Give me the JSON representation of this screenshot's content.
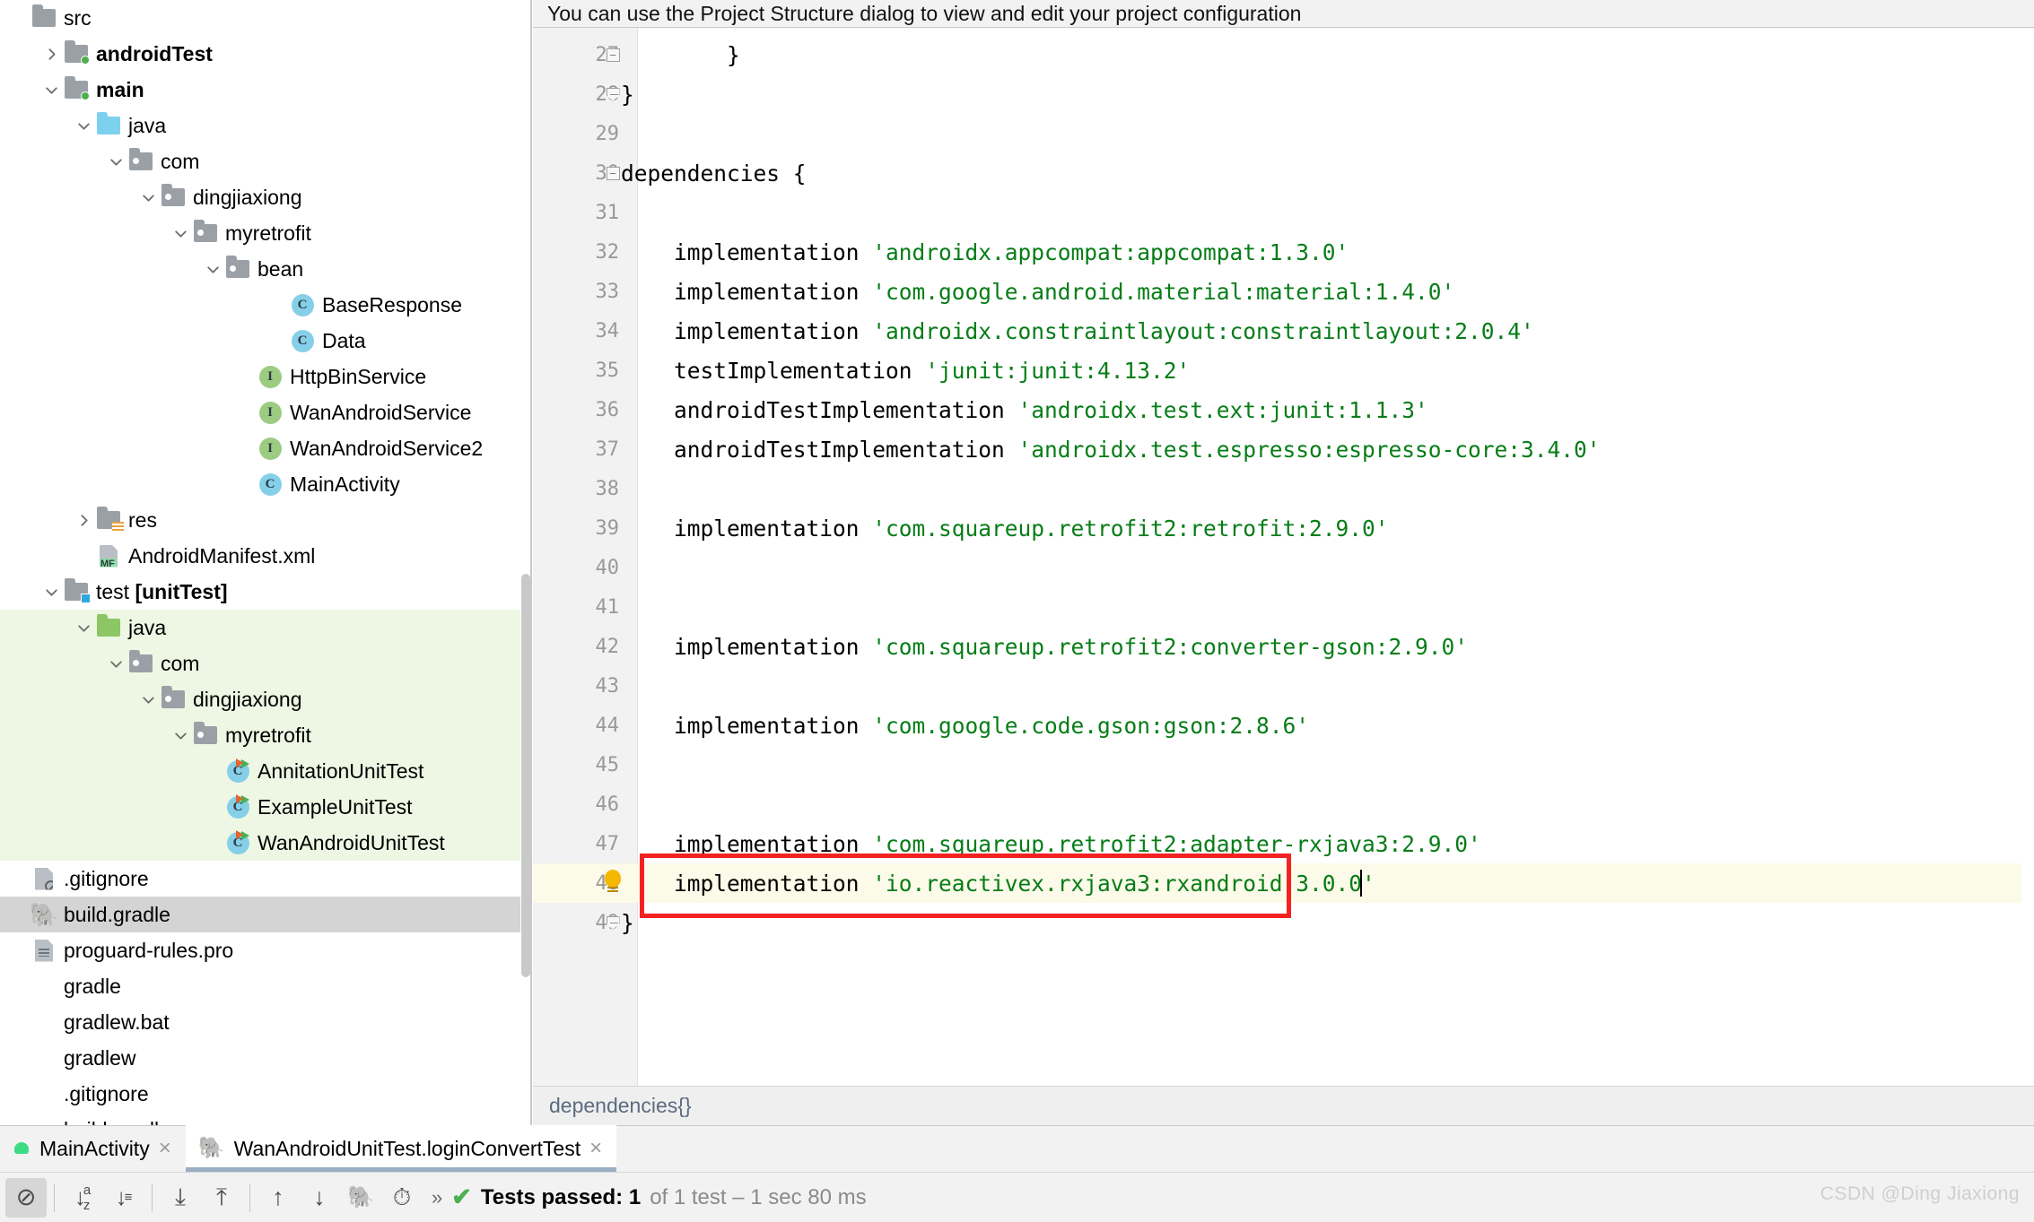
{
  "notification": {
    "text": "You can use the Project Structure dialog to view and edit your project configuration"
  },
  "project_tree": {
    "rows": [
      {
        "label": "src",
        "indent": 0,
        "icon": "folder-gray",
        "arrow": "none",
        "bold": false,
        "highlight": "none"
      },
      {
        "label": "androidTest",
        "indent": 1,
        "icon": "folder-source-green",
        "arrow": "collapsed",
        "bold": true,
        "highlight": "none"
      },
      {
        "label": "main",
        "indent": 1,
        "icon": "folder-source-green",
        "arrow": "expanded",
        "bold": true,
        "highlight": "none"
      },
      {
        "label": "java",
        "indent": 2,
        "icon": "folder-blue",
        "arrow": "expanded",
        "bold": false,
        "highlight": "none"
      },
      {
        "label": "com",
        "indent": 3,
        "icon": "folder-package",
        "arrow": "expanded",
        "bold": false,
        "highlight": "none"
      },
      {
        "label": "dingjiaxiong",
        "indent": 4,
        "icon": "folder-package",
        "arrow": "expanded",
        "bold": false,
        "highlight": "none"
      },
      {
        "label": "myretrofit",
        "indent": 5,
        "icon": "folder-package",
        "arrow": "expanded",
        "bold": false,
        "highlight": "none"
      },
      {
        "label": "bean",
        "indent": 6,
        "icon": "folder-package",
        "arrow": "expanded",
        "bold": false,
        "highlight": "none"
      },
      {
        "label": "BaseResponse",
        "indent": 8,
        "icon": "class-icon",
        "arrow": "none",
        "bold": false,
        "highlight": "none"
      },
      {
        "label": "Data",
        "indent": 8,
        "icon": "class-icon",
        "arrow": "none",
        "bold": false,
        "highlight": "none"
      },
      {
        "label": "HttpBinService",
        "indent": 7,
        "icon": "interface-icon",
        "arrow": "none",
        "bold": false,
        "highlight": "none"
      },
      {
        "label": "WanAndroidService",
        "indent": 7,
        "icon": "interface-icon",
        "arrow": "none",
        "bold": false,
        "highlight": "none"
      },
      {
        "label": "WanAndroidService2",
        "indent": 7,
        "icon": "interface-icon",
        "arrow": "none",
        "bold": false,
        "highlight": "none"
      },
      {
        "label": "MainActivity",
        "indent": 7,
        "icon": "class-icon",
        "arrow": "none",
        "bold": false,
        "highlight": "none"
      },
      {
        "label": "res",
        "indent": 2,
        "icon": "folder-res",
        "arrow": "collapsed",
        "bold": false,
        "highlight": "none"
      },
      {
        "label": "AndroidManifest.xml",
        "indent": 2,
        "icon": "manifest-icon",
        "arrow": "none",
        "bold": false,
        "highlight": "none"
      },
      {
        "label": "test [unitTest]",
        "indent": 1,
        "icon": "folder-source-blue",
        "arrow": "expanded",
        "bold": false,
        "highlight": "none"
      },
      {
        "label": "java",
        "indent": 2,
        "icon": "folder-green",
        "arrow": "expanded",
        "bold": false,
        "highlight": "green"
      },
      {
        "label": "com",
        "indent": 3,
        "icon": "folder-package",
        "arrow": "expanded",
        "bold": false,
        "highlight": "green"
      },
      {
        "label": "dingjiaxiong",
        "indent": 4,
        "icon": "folder-package",
        "arrow": "expanded",
        "bold": false,
        "highlight": "green"
      },
      {
        "label": "myretrofit",
        "indent": 5,
        "icon": "folder-package",
        "arrow": "expanded",
        "bold": false,
        "highlight": "green"
      },
      {
        "label": "AnnitationUnitTest",
        "indent": 6,
        "icon": "test-class-icon",
        "arrow": "none",
        "bold": false,
        "highlight": "green"
      },
      {
        "label": "ExampleUnitTest",
        "indent": 6,
        "icon": "test-class-icon",
        "arrow": "none",
        "bold": false,
        "highlight": "green"
      },
      {
        "label": "WanAndroidUnitTest",
        "indent": 6,
        "icon": "test-class-icon",
        "arrow": "none",
        "bold": false,
        "highlight": "green"
      },
      {
        "label": ".gitignore",
        "indent": 0,
        "icon": "gitignore-icon",
        "arrow": "none",
        "bold": false,
        "highlight": "none"
      },
      {
        "label": "build.gradle",
        "indent": 0,
        "icon": "gradle-icon",
        "arrow": "none",
        "bold": false,
        "highlight": "gray"
      },
      {
        "label": "proguard-rules.pro",
        "indent": 0,
        "icon": "text-file-icon",
        "arrow": "none",
        "bold": false,
        "highlight": "none"
      },
      {
        "label": "gradle",
        "indent": 0,
        "icon": "none",
        "arrow": "none",
        "bold": false,
        "highlight": "none"
      },
      {
        "label": "gradlew.bat",
        "indent": 0,
        "icon": "none",
        "arrow": "none",
        "bold": false,
        "highlight": "none"
      },
      {
        "label": "gradlew",
        "indent": 0,
        "icon": "none",
        "arrow": "none",
        "bold": false,
        "highlight": "none"
      },
      {
        "label": ".gitignore",
        "indent": 0,
        "icon": "none",
        "arrow": "none",
        "bold": false,
        "highlight": "none"
      },
      {
        "label": "build.gradle",
        "indent": 0,
        "icon": "none",
        "arrow": "none",
        "bold": false,
        "highlight": "none"
      }
    ]
  },
  "editor": {
    "lines": [
      {
        "num": "27",
        "code": "        }",
        "fold": "minus",
        "current": false
      },
      {
        "num": "28",
        "code": "}",
        "fold": "end",
        "current": false
      },
      {
        "num": "29",
        "code": "",
        "fold": "none",
        "current": false
      },
      {
        "num": "30",
        "code": "dependencies {",
        "fold": "start",
        "current": false
      },
      {
        "num": "31",
        "code": "",
        "fold": "none",
        "current": false
      },
      {
        "num": "32",
        "code": "    implementation 'androidx.appcompat:appcompat:1.3.0'",
        "fold": "none",
        "current": false
      },
      {
        "num": "33",
        "code": "    implementation 'com.google.android.material:material:1.4.0'",
        "fold": "none",
        "current": false
      },
      {
        "num": "34",
        "code": "    implementation 'androidx.constraintlayout:constraintlayout:2.0.4'",
        "fold": "none",
        "current": false
      },
      {
        "num": "35",
        "code": "    testImplementation 'junit:junit:4.13.2'",
        "fold": "none",
        "current": false
      },
      {
        "num": "36",
        "code": "    androidTestImplementation 'androidx.test.ext:junit:1.1.3'",
        "fold": "none",
        "current": false
      },
      {
        "num": "37",
        "code": "    androidTestImplementation 'androidx.test.espresso:espresso-core:3.4.0'",
        "fold": "none",
        "current": false
      },
      {
        "num": "38",
        "code": "",
        "fold": "none",
        "current": false
      },
      {
        "num": "39",
        "code": "    implementation 'com.squareup.retrofit2:retrofit:2.9.0'",
        "fold": "none",
        "current": false
      },
      {
        "num": "40",
        "code": "",
        "fold": "none",
        "current": false
      },
      {
        "num": "41",
        "code": "",
        "fold": "none",
        "current": false
      },
      {
        "num": "42",
        "code": "    implementation 'com.squareup.retrofit2:converter-gson:2.9.0'",
        "fold": "none",
        "current": false
      },
      {
        "num": "43",
        "code": "",
        "fold": "none",
        "current": false
      },
      {
        "num": "44",
        "code": "    implementation 'com.google.code.gson:gson:2.8.6'",
        "fold": "none",
        "current": false
      },
      {
        "num": "45",
        "code": "",
        "fold": "none",
        "current": false
      },
      {
        "num": "46",
        "code": "",
        "fold": "none",
        "current": false
      },
      {
        "num": "47",
        "code": "    implementation 'com.squareup.retrofit2:adapter-rxjava3:2.9.0'",
        "fold": "none",
        "current": false
      },
      {
        "num": "48",
        "code": "    implementation 'io.reactivex.rxjava3:rxandroid:3.0.0'",
        "fold": "bulb",
        "current": true
      },
      {
        "num": "49",
        "code": "}",
        "fold": "end",
        "current": false
      }
    ],
    "breadcrumb": "dependencies{}"
  },
  "tabs": [
    {
      "label": "MainActivity",
      "icon": "android-icon",
      "active": false,
      "close": "×"
    },
    {
      "label": "WanAndroidUnitTest.loginConvertTest",
      "icon": "gradle-icon",
      "active": true,
      "close": "×"
    }
  ],
  "bottom_toolbar": {
    "buttons": [
      {
        "name": "hide-passed-icon",
        "glyph": "⊘",
        "active": true
      },
      {
        "name": "sort-alphabetically-icon",
        "glyph": "↓",
        "active": false
      },
      {
        "name": "sort-by-duration-icon",
        "glyph": "↓",
        "active": false
      },
      {
        "name": "expand-all-icon",
        "glyph": "⤓",
        "active": false
      },
      {
        "name": "collapse-all-icon",
        "glyph": "⤒",
        "active": false
      },
      {
        "name": "previous-failed-icon",
        "glyph": "↑",
        "active": false
      },
      {
        "name": "next-failed-icon",
        "glyph": "↓",
        "active": false
      },
      {
        "name": "rerun-gradle-icon",
        "glyph": "↱",
        "active": false
      },
      {
        "name": "history-icon",
        "glyph": "◴",
        "active": false
      }
    ],
    "more_glyph": "»",
    "status": {
      "check": "✔",
      "strong": "Tests passed: 1",
      "dim": " of 1 test – 1 sec 80 ms"
    }
  },
  "watermark": {
    "text": "CSDN @Ding Jiaxiong"
  },
  "colors": {
    "string_green": "#067d17",
    "highlight_red": "#f42121",
    "current_line": "#fcfae8",
    "test_scope_green": "#eef7e3",
    "selection_gray": "#d4d4d4",
    "pass_green": "#4caf50"
  }
}
